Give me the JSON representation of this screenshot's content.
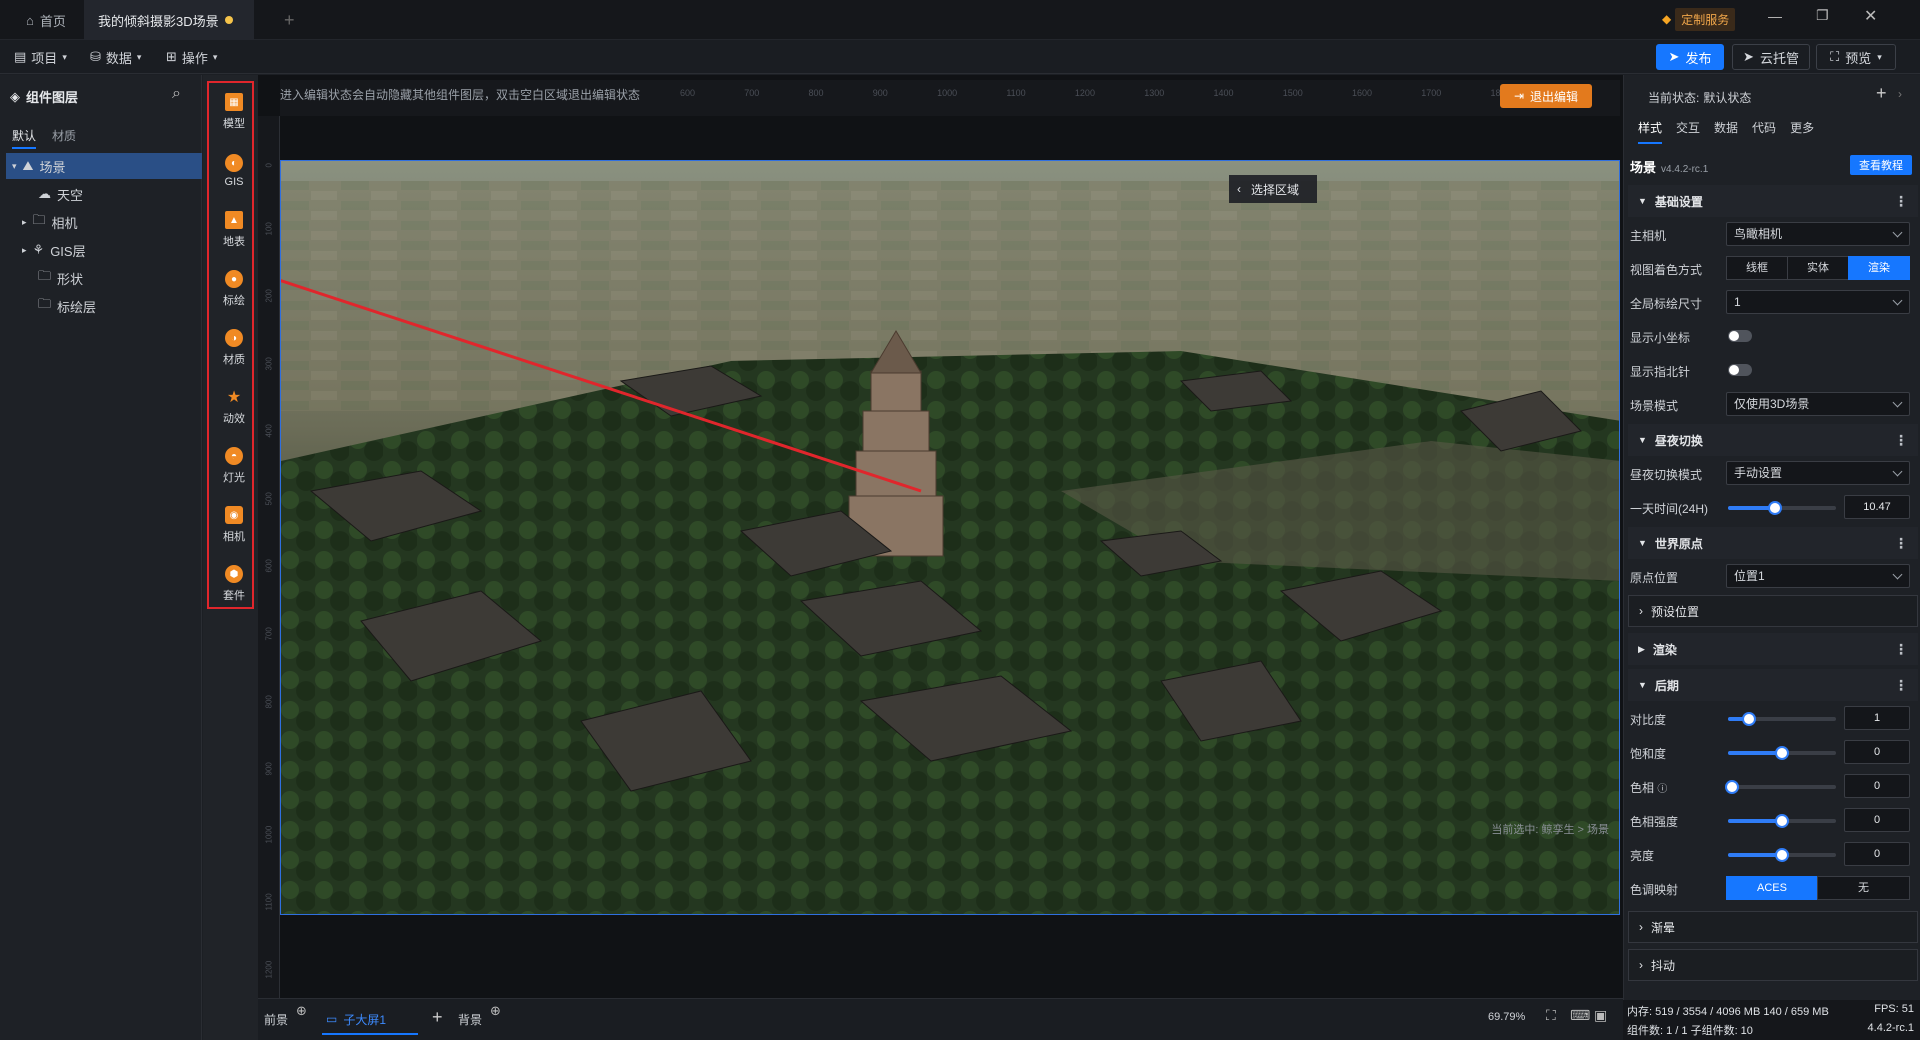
{
  "titlebar": {
    "home_tab": "首页",
    "doc_tab": "我的倾斜摄影3D场景",
    "custom_service": "定制服务"
  },
  "menubar": {
    "project": "项目",
    "data": "数据",
    "operate": "操作",
    "publish": "发布",
    "cloud": "云托管",
    "preview": "预览"
  },
  "leftpanel": {
    "title": "组件图层",
    "tabs": [
      "默认",
      "材质"
    ],
    "tree": [
      "场景",
      "天空",
      "相机",
      "GIS层",
      "形状",
      "标绘层"
    ]
  },
  "toolstrip": [
    "模型",
    "GIS",
    "地表",
    "标绘",
    "材质",
    "动效",
    "灯光",
    "相机",
    "套件"
  ],
  "canvas": {
    "notice": "进入编辑状态会自动隐藏其他组件图层，双击空白区域退出编辑状态",
    "exit_edit": "退出编辑",
    "select_area": "选择区域",
    "breadcrumb": "当前选中: 鲸孪生 > 场景",
    "ruler_top": [
      "600",
      "700",
      "800",
      "900",
      "1000",
      "1100",
      "1200",
      "1300",
      "1400",
      "1500",
      "1600",
      "1700",
      "1800",
      "1900"
    ],
    "ruler_left": [
      "0",
      "100",
      "200",
      "300",
      "400",
      "500",
      "600",
      "700",
      "800",
      "900",
      "1000",
      "1100",
      "1200"
    ]
  },
  "bottombar": {
    "foreground": "前景",
    "screen_tab": "子大屏1",
    "background": "背景",
    "zoom": "69.79%"
  },
  "rightpanel": {
    "state_label": "当前状态:",
    "state_value": "默认状态",
    "tabs": [
      "样式",
      "交互",
      "数据",
      "代码",
      "更多"
    ],
    "component_name": "场景",
    "version": "v4.4.2-rc.1",
    "tutorial": "查看教程",
    "sections": {
      "basic": "基础设置",
      "daynight": "昼夜切换",
      "origin": "世界原点",
      "preset": "预设位置",
      "render": "渲染",
      "post": "后期",
      "vignette": "渐晕",
      "shake": "抖动"
    },
    "main_camera_label": "主相机",
    "main_camera": "鸟瞰相机",
    "shading_label": "视图着色方式",
    "shading_options": [
      "线框",
      "实体",
      "渲染"
    ],
    "marker_size_label": "全局标绘尺寸",
    "marker_size": "1",
    "show_axis_label": "显示小坐标",
    "show_compass_label": "显示指北针",
    "scene_mode_label": "场景模式",
    "scene_mode": "仅使用3D场景",
    "daynight_mode_label": "昼夜切换模式",
    "daynight_mode": "手动设置",
    "time_label": "一天时间(24H)",
    "time_value": "10.47",
    "time_fraction": 0.436,
    "origin_label": "原点位置",
    "origin_value": "位置1",
    "contrast_label": "对比度",
    "contrast": "1",
    "saturation_label": "饱和度",
    "saturation": "0",
    "hue_label": "色相",
    "hue": "0",
    "hue_strength_label": "色相强度",
    "hue_strength": "0",
    "brightness_label": "亮度",
    "brightness": "0",
    "tonemap_label": "色调映射",
    "tonemap_options": [
      "ACES",
      "无"
    ]
  },
  "statusbar": {
    "memory": "内存: 519 / 3554 / 4096 MB  140 / 659 MB",
    "fps": "FPS: 51",
    "components": "组件数: 1 / 1   子组件数: 10",
    "version": "4.4.2-rc.1"
  },
  "colors": {
    "accent": "#1677ff",
    "highlight_box": "#e0262c",
    "tool_icon": "#f08a24"
  }
}
